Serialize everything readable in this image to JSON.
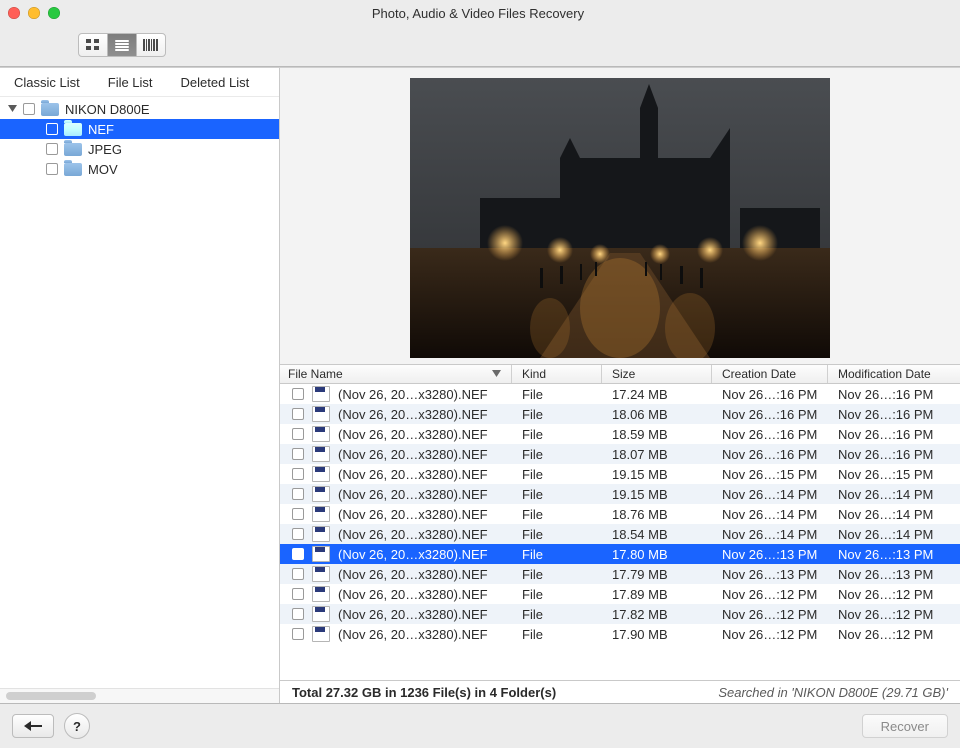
{
  "window": {
    "title": "Photo, Audio & Video Files Recovery"
  },
  "tabs": {
    "classic": "Classic List",
    "file": "File List",
    "deleted": "Deleted List"
  },
  "tree": {
    "root": "NIKON D800E",
    "children": [
      {
        "label": "NEF",
        "selected": true
      },
      {
        "label": "JPEG",
        "selected": false
      },
      {
        "label": "MOV",
        "selected": false
      }
    ]
  },
  "columns": {
    "name": "File Name",
    "kind": "Kind",
    "size": "Size",
    "cdate": "Creation Date",
    "mdate": "Modification Date"
  },
  "files": [
    {
      "name": "(Nov 26, 20…x3280).NEF",
      "kind": "File",
      "size": "17.24 MB",
      "cdate": "Nov 26…:16 PM",
      "mdate": "Nov 26…:16 PM"
    },
    {
      "name": "(Nov 26, 20…x3280).NEF",
      "kind": "File",
      "size": "18.06 MB",
      "cdate": "Nov 26…:16 PM",
      "mdate": "Nov 26…:16 PM"
    },
    {
      "name": "(Nov 26, 20…x3280).NEF",
      "kind": "File",
      "size": "18.59 MB",
      "cdate": "Nov 26…:16 PM",
      "mdate": "Nov 26…:16 PM"
    },
    {
      "name": "(Nov 26, 20…x3280).NEF",
      "kind": "File",
      "size": "18.07 MB",
      "cdate": "Nov 26…:16 PM",
      "mdate": "Nov 26…:16 PM"
    },
    {
      "name": "(Nov 26, 20…x3280).NEF",
      "kind": "File",
      "size": "19.15 MB",
      "cdate": "Nov 26…:15 PM",
      "mdate": "Nov 26…:15 PM"
    },
    {
      "name": "(Nov 26, 20…x3280).NEF",
      "kind": "File",
      "size": "19.15 MB",
      "cdate": "Nov 26…:14 PM",
      "mdate": "Nov 26…:14 PM"
    },
    {
      "name": "(Nov 26, 20…x3280).NEF",
      "kind": "File",
      "size": "18.76 MB",
      "cdate": "Nov 26…:14 PM",
      "mdate": "Nov 26…:14 PM"
    },
    {
      "name": "(Nov 26, 20…x3280).NEF",
      "kind": "File",
      "size": "18.54 MB",
      "cdate": "Nov 26…:14 PM",
      "mdate": "Nov 26…:14 PM"
    },
    {
      "name": "(Nov 26, 20…x3280).NEF",
      "kind": "File",
      "size": "17.80 MB",
      "cdate": "Nov 26…:13 PM",
      "mdate": "Nov 26…:13 PM",
      "selected": true
    },
    {
      "name": "(Nov 26, 20…x3280).NEF",
      "kind": "File",
      "size": "17.79 MB",
      "cdate": "Nov 26…:13 PM",
      "mdate": "Nov 26…:13 PM"
    },
    {
      "name": "(Nov 26, 20…x3280).NEF",
      "kind": "File",
      "size": "17.89 MB",
      "cdate": "Nov 26…:12 PM",
      "mdate": "Nov 26…:12 PM"
    },
    {
      "name": "(Nov 26, 20…x3280).NEF",
      "kind": "File",
      "size": "17.82 MB",
      "cdate": "Nov 26…:12 PM",
      "mdate": "Nov 26…:12 PM"
    },
    {
      "name": "(Nov 26, 20…x3280).NEF",
      "kind": "File",
      "size": "17.90 MB",
      "cdate": "Nov 26…:12 PM",
      "mdate": "Nov 26…:12 PM"
    }
  ],
  "status": {
    "summary": "Total 27.32 GB in 1236 File(s) in 4 Folder(s)",
    "searched": "Searched in 'NIKON D800E (29.71 GB)'"
  },
  "footer": {
    "back": "←",
    "help": "?",
    "recover": "Recover"
  }
}
